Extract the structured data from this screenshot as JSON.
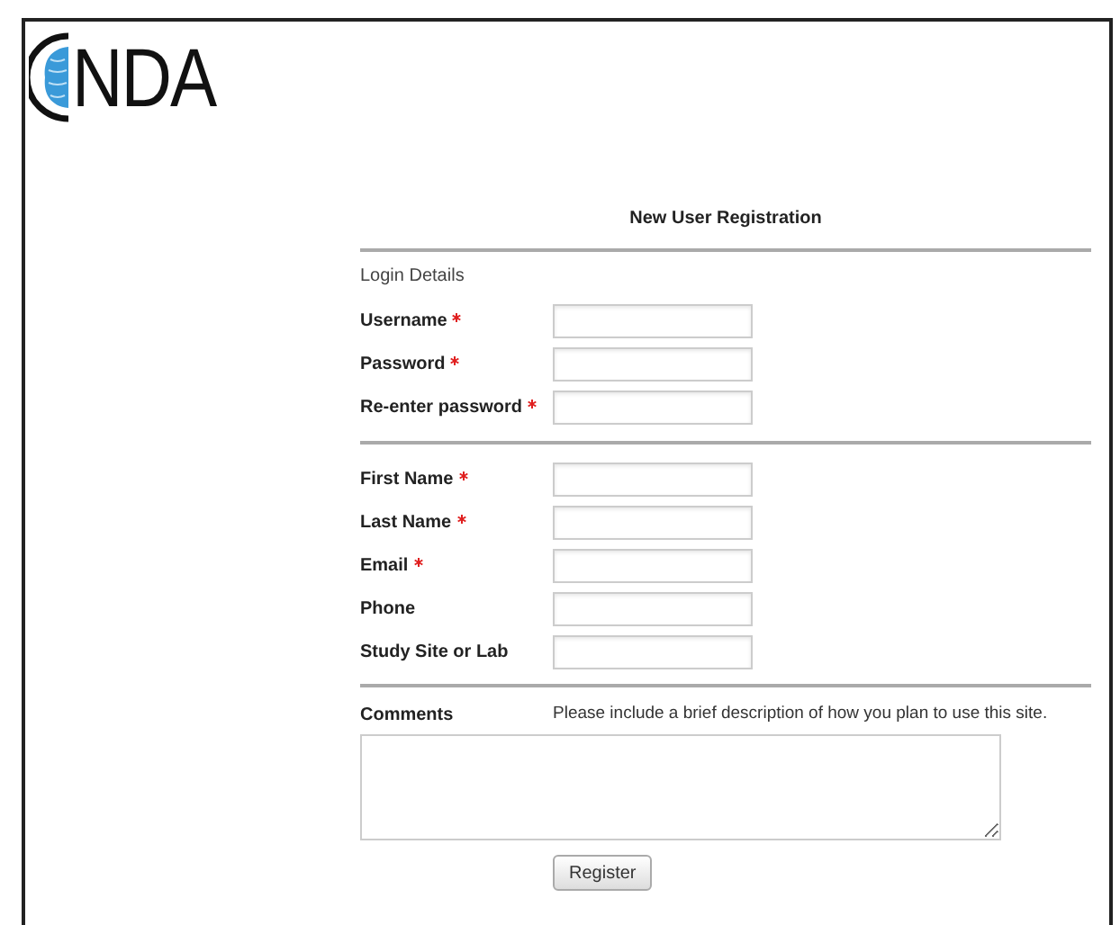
{
  "logo": {
    "text": "NDA"
  },
  "form": {
    "title": "New User Registration",
    "sections": [
      {
        "heading": "Login Details",
        "fields": [
          {
            "label": "Username",
            "required": true
          },
          {
            "label": "Password",
            "required": true
          },
          {
            "label": "Re-enter password",
            "required": true
          }
        ]
      },
      {
        "fields": [
          {
            "label": "First Name",
            "required": true
          },
          {
            "label": "Last Name",
            "required": true
          },
          {
            "label": "Email",
            "required": true
          },
          {
            "label": "Phone",
            "required": false
          },
          {
            "label": "Study Site or Lab",
            "required": false
          }
        ]
      }
    ],
    "comments": {
      "label": "Comments",
      "hint": "Please include a brief description of how you plan to use this site."
    },
    "submit": "Register"
  }
}
